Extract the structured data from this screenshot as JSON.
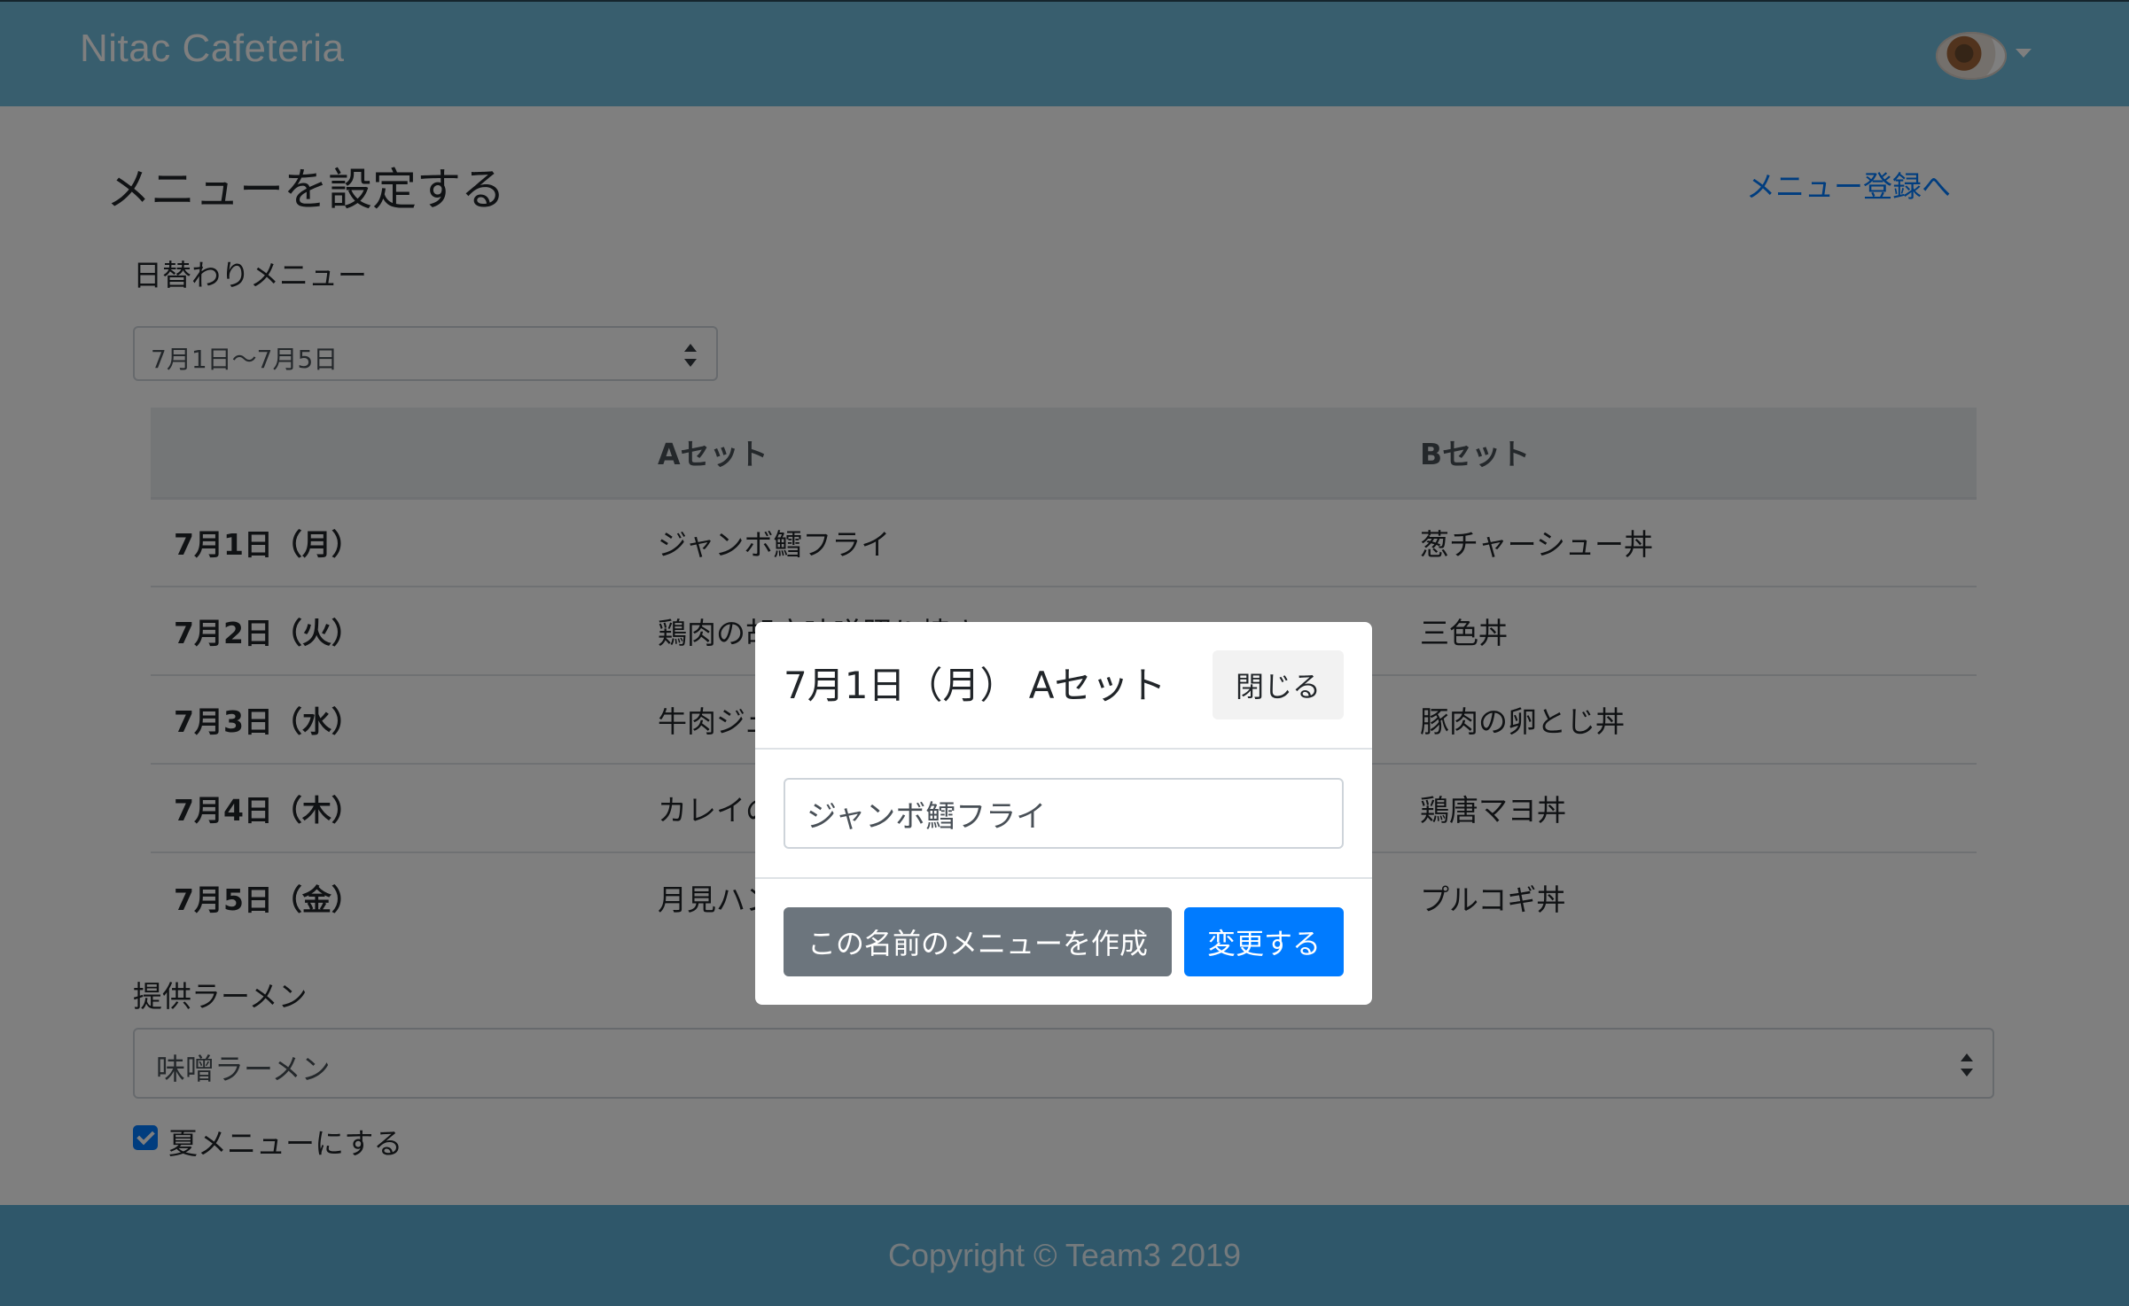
{
  "navbar": {
    "brand": "Nitac Cafeteria",
    "avatar_icon": "user-avatar-food-icon"
  },
  "page": {
    "title": "メニューを設定する",
    "register_link": "メニュー登録へ"
  },
  "daily_menu": {
    "label": "日替わりメニュー",
    "week_selected": "7月1日〜7月5日",
    "columns": [
      "",
      "Aセット",
      "Bセット"
    ],
    "rows": [
      {
        "day": "7月1日（月）",
        "a": "ジャンボ鱈フライ",
        "b": "葱チャーシュー丼"
      },
      {
        "day": "7月2日（火）",
        "a": "鶏肉の胡麻味噌照り焼き",
        "b": "三色丼"
      },
      {
        "day": "7月3日（水）",
        "a": "牛肉ジュ",
        "b": "豚肉の卵とじ丼"
      },
      {
        "day": "7月4日（木）",
        "a": "カレイの",
        "b": "鶏唐マヨ丼"
      },
      {
        "day": "7月5日（金）",
        "a": "月見ハン",
        "b": "プルコギ丼"
      }
    ]
  },
  "ramen": {
    "label": "提供ラーメン",
    "selected": "味噌ラーメン"
  },
  "summer": {
    "label": "夏メニューにする",
    "checked": true
  },
  "footer": {
    "copyright": "Copyright © Team3 2019"
  },
  "modal": {
    "title": "7月1日（月） Aセット",
    "close_label": "閉じる",
    "input_value": "ジャンボ鱈フライ",
    "create_label": "この名前のメニューを作成",
    "change_label": "変更する"
  },
  "colors": {
    "navbar": "#70bcdd",
    "footer": "#5eaed4",
    "primary": "#007bff",
    "secondary": "#6c757d"
  }
}
